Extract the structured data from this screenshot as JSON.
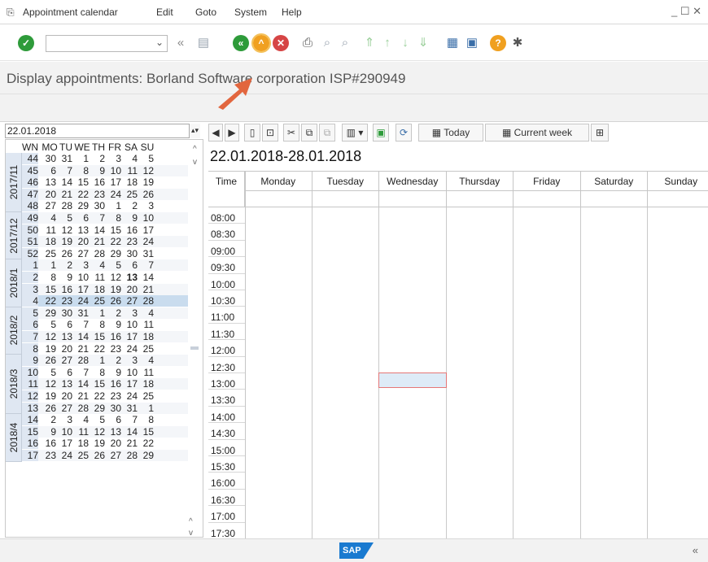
{
  "menu": {
    "items": [
      "Appointment calendar",
      "Edit",
      "Goto",
      "System",
      "Help"
    ]
  },
  "title": {
    "text": "Display appointments: Borland Software corporation ISP#290949"
  },
  "date_field": {
    "value": "22.01.2018"
  },
  "nav": {
    "headers": [
      "WN",
      "MO",
      "TU",
      "WE",
      "TH",
      "FR",
      "SA",
      "SU"
    ],
    "weeks": [
      [
        "44",
        "30",
        "31",
        "1",
        "2",
        "3",
        "4",
        "5"
      ],
      [
        "45",
        "6",
        "7",
        "8",
        "9",
        "10",
        "11",
        "12"
      ],
      [
        "46",
        "13",
        "14",
        "15",
        "16",
        "17",
        "18",
        "19"
      ],
      [
        "47",
        "20",
        "21",
        "22",
        "23",
        "24",
        "25",
        "26"
      ],
      [
        "48",
        "27",
        "28",
        "29",
        "30",
        "1",
        "2",
        "3"
      ],
      [
        "49",
        "4",
        "5",
        "6",
        "7",
        "8",
        "9",
        "10"
      ],
      [
        "50",
        "11",
        "12",
        "13",
        "14",
        "15",
        "16",
        "17"
      ],
      [
        "51",
        "18",
        "19",
        "20",
        "21",
        "22",
        "23",
        "24"
      ],
      [
        "52",
        "25",
        "26",
        "27",
        "28",
        "29",
        "30",
        "31"
      ],
      [
        "1",
        "1",
        "2",
        "3",
        "4",
        "5",
        "6",
        "7"
      ],
      [
        "2",
        "8",
        "9",
        "10",
        "11",
        "12",
        "13",
        "14"
      ],
      [
        "3",
        "15",
        "16",
        "17",
        "18",
        "19",
        "20",
        "21"
      ],
      [
        "4",
        "22",
        "23",
        "24",
        "25",
        "26",
        "27",
        "28"
      ],
      [
        "5",
        "29",
        "30",
        "31",
        "1",
        "2",
        "3",
        "4"
      ],
      [
        "6",
        "5",
        "6",
        "7",
        "8",
        "9",
        "10",
        "11"
      ],
      [
        "7",
        "12",
        "13",
        "14",
        "15",
        "16",
        "17",
        "18"
      ],
      [
        "8",
        "19",
        "20",
        "21",
        "22",
        "23",
        "24",
        "25"
      ],
      [
        "9",
        "26",
        "27",
        "28",
        "1",
        "2",
        "3",
        "4"
      ],
      [
        "10",
        "5",
        "6",
        "7",
        "8",
        "9",
        "10",
        "11"
      ],
      [
        "11",
        "12",
        "13",
        "14",
        "15",
        "16",
        "17",
        "18"
      ],
      [
        "12",
        "19",
        "20",
        "21",
        "22",
        "23",
        "24",
        "25"
      ],
      [
        "13",
        "26",
        "27",
        "28",
        "29",
        "30",
        "31",
        "1"
      ],
      [
        "14",
        "2",
        "3",
        "4",
        "5",
        "6",
        "7",
        "8"
      ],
      [
        "15",
        "9",
        "10",
        "11",
        "12",
        "13",
        "14",
        "15"
      ],
      [
        "16",
        "16",
        "17",
        "18",
        "19",
        "20",
        "21",
        "22"
      ],
      [
        "17",
        "23",
        "24",
        "25",
        "26",
        "27",
        "28",
        "29"
      ]
    ],
    "months": [
      {
        "label": "2017/11",
        "start": 0,
        "count": 5
      },
      {
        "label": "2017/12",
        "start": 5,
        "count": 4
      },
      {
        "label": "2018/1",
        "start": 9,
        "count": 4
      },
      {
        "label": "2018/2",
        "start": 13,
        "count": 4
      },
      {
        "label": "2018/3",
        "start": 17,
        "count": 5
      },
      {
        "label": "2018/4",
        "start": 22,
        "count": 4
      }
    ],
    "current_week_index": 12,
    "bold_day": "13"
  },
  "toolbar": {
    "today_label": "Today",
    "current_week_label": "Current week"
  },
  "week": {
    "title": "22.01.2018-28.01.2018",
    "time_header": "Time",
    "days": [
      "Monday",
      "Tuesday",
      "Wednesday",
      "Thursday",
      "Friday",
      "Saturday",
      "Sunday"
    ],
    "times": [
      "08:00",
      "08:30",
      "09:00",
      "09:30",
      "10:00",
      "10:30",
      "11:00",
      "11:30",
      "12:00",
      "12:30",
      "13:00",
      "13:30",
      "14:00",
      "14:30",
      "15:00",
      "15:30",
      "16:00",
      "16:30",
      "17:00",
      "17:30"
    ]
  },
  "status": {
    "logo": "SAP",
    "collapse": "«"
  },
  "colors": {
    "ok_green": "#2e9b3a",
    "nav_green": "#2e9b3a",
    "cancel_red": "#d64545",
    "help_orange": "#f0a020",
    "arrow": "#e2663e",
    "current_week_bg": "#c9dcee"
  }
}
